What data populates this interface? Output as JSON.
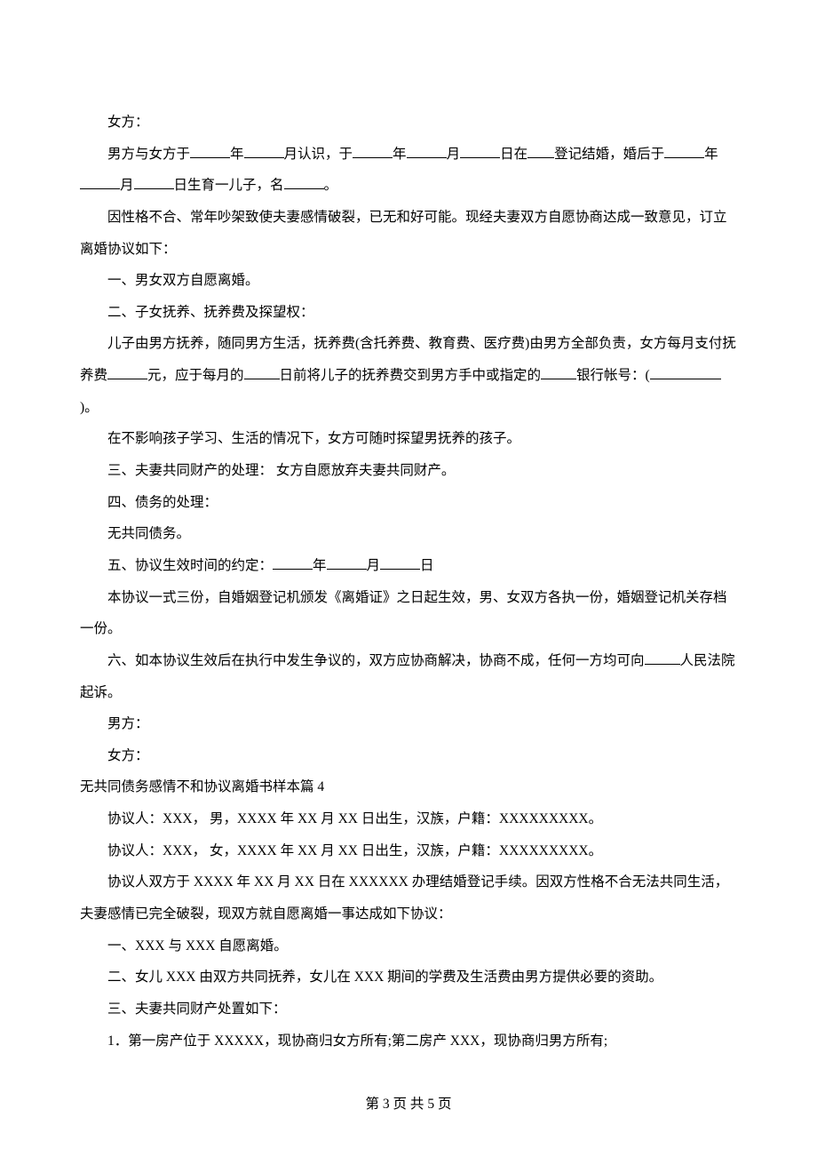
{
  "paragraphs": {
    "p1": "女方：",
    "p2_1": "男方与女方于",
    "p2_2": "年",
    "p2_3": "月认识，于",
    "p2_4": "年",
    "p2_5": "月",
    "p2_6": "日在",
    "p2_7": "登记结婚，婚后于",
    "p2_8": "年",
    "p2_9": "月",
    "p2_10": "日生育一儿子，名",
    "p2_11": "。",
    "p3": "因性格不合、常年吵架致使夫妻感情破裂，已无和好可能。现经夫妻双方自愿协商达成一致意见，订立离婚协议如下：",
    "p4": "一、男女双方自愿离婚。",
    "p5": "二、子女抚养、抚养费及探望权：",
    "p6_1": "儿子由男方抚养，随同男方生活，抚养费(含托养费、教育费、医疗费)由男方全部负责，女方每月支付抚养费",
    "p6_2": "元，应于每月的",
    "p6_3": "日前将儿子的抚养费交到男方手中或指定的",
    "p6_4": "银行帐号：(",
    "p6_5": ")。",
    "p7": "在不影响孩子学习、生活的情况下，女方可随时探望男抚养的孩子。",
    "p8": "三、夫妻共同财产的处理：  女方自愿放弃夫妻共同财产。",
    "p9": "四、债务的处理：",
    "p10": "无共同债务。",
    "p11_1": "五、协议生效时间的约定：",
    "p11_2": "年",
    "p11_3": "月",
    "p11_4": "日",
    "p12": "本协议一式三份，自婚姻登记机颁发《离婚证》之日起生效，男、女双方各执一份，婚姻登记机关存档一份。",
    "p13_1": "六、如本协议生效后在执行中发生争议的，双方应协商解决，协商不成，任何一方均可向",
    "p13_2": "人民法院起诉。",
    "p14": "男方：",
    "p15": "女方：",
    "h2": "无共同债务感情不和协议离婚书样本篇 4",
    "p16": "协议人：XXX，  男，XXXX 年 XX 月 XX 日出生，汉族，户籍：XXXXXXXXX。",
    "p17": "协议人：XXX，  女，XXXX 年 XX 月 XX 日出生，汉族，户籍：XXXXXXXXX。",
    "p18": "协议人双方于 XXXX 年 XX 月 XX 日在 XXXXXX 办理结婚登记手续。因双方性格不合无法共同生活，夫妻感情已完全破裂，现双方就自愿离婚一事达成如下协议：",
    "p19": "一、XXX 与 XXX 自愿离婚。",
    "p20": "二、女儿 XXX 由双方共同抚养，女儿在 XXX 期间的学费及生活费由男方提供必要的资助。",
    "p21": "三、夫妻共同财产处置如下：",
    "p22": "1．第一房产位于 XXXXX，现协商归女方所有;第二房产 XXX，现协商归男方所有;"
  },
  "footer": {
    "prefix": "第 ",
    "page": "3",
    "middle": " 页 共 ",
    "total": "5",
    "suffix": " 页"
  }
}
